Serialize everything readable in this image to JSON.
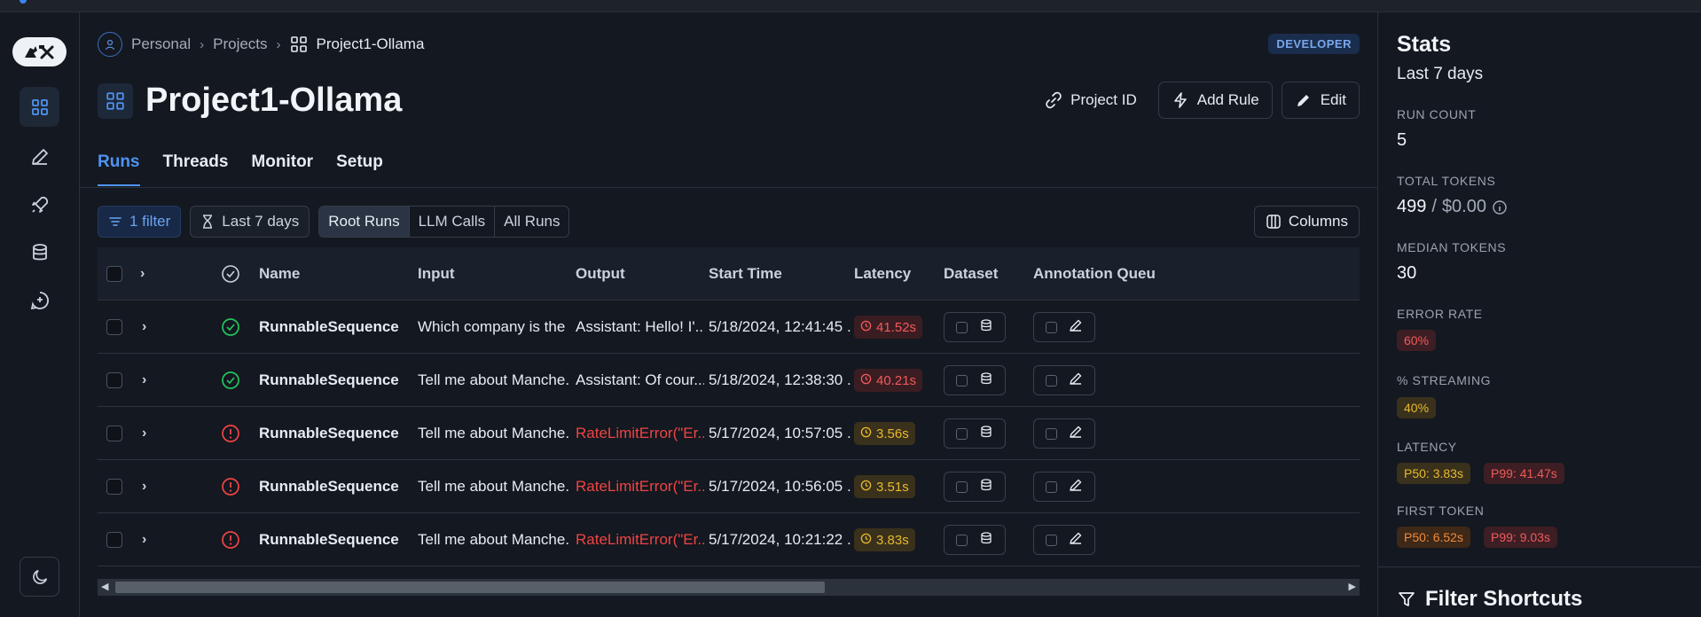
{
  "breadcrumb": {
    "items": [
      "Personal",
      "Projects"
    ],
    "current": "Project1-Ollama"
  },
  "badge": "DEVELOPER",
  "page": {
    "title": "Project1-Ollama"
  },
  "actions": {
    "project_id": "Project ID",
    "add_rule": "Add Rule",
    "edit": "Edit"
  },
  "tabs": [
    "Runs",
    "Threads",
    "Monitor",
    "Setup"
  ],
  "filters": {
    "filter_count": "1 filter",
    "time_range": "Last 7 days",
    "segments": [
      "Root Runs",
      "LLM Calls",
      "All Runs"
    ],
    "selected_segment": "Root Runs",
    "columns": "Columns"
  },
  "table": {
    "headers": {
      "name": "Name",
      "input": "Input",
      "output": "Output",
      "start_time": "Start Time",
      "latency": "Latency",
      "dataset": "Dataset",
      "annotation": "Annotation Queu"
    },
    "rows": [
      {
        "status": "success",
        "name": "RunnableSequence",
        "input": "Which company is the ...",
        "output": "Assistant: Hello! I'...",
        "output_error": false,
        "start_time": "5/18/2024, 12:41:45 ...",
        "latency": "41.52s",
        "latency_level": "red"
      },
      {
        "status": "success",
        "name": "RunnableSequence",
        "input": "Tell me about Manche...",
        "output": "Assistant: Of cour...",
        "output_error": false,
        "start_time": "5/18/2024, 12:38:30 ...",
        "latency": "40.21s",
        "latency_level": "red"
      },
      {
        "status": "error",
        "name": "RunnableSequence",
        "input": "Tell me about Manche...",
        "output": "RateLimitError(\"Er...",
        "output_error": true,
        "start_time": "5/17/2024, 10:57:05 ...",
        "latency": "3.56s",
        "latency_level": "yellow"
      },
      {
        "status": "error",
        "name": "RunnableSequence",
        "input": "Tell me about Manche...",
        "output": "RateLimitError(\"Er...",
        "output_error": true,
        "start_time": "5/17/2024, 10:56:05 ...",
        "latency": "3.51s",
        "latency_level": "yellow"
      },
      {
        "status": "error",
        "name": "RunnableSequence",
        "input": "Tell me about Manche...",
        "output": "RateLimitError(\"Er...",
        "output_error": true,
        "start_time": "5/17/2024, 10:21:22 ...",
        "latency": "3.83s",
        "latency_level": "yellow"
      }
    ]
  },
  "stats": {
    "title": "Stats",
    "subtitle": "Last 7 days",
    "run_count_label": "RUN COUNT",
    "run_count": "5",
    "total_tokens_label": "TOTAL TOKENS",
    "total_tokens": "499",
    "total_cost": "$0.00",
    "median_tokens_label": "MEDIAN TOKENS",
    "median_tokens": "30",
    "error_rate_label": "ERROR RATE",
    "error_rate": "60%",
    "streaming_label": "% STREAMING",
    "streaming": "40%",
    "latency_label": "LATENCY",
    "latency_p50": "P50: 3.83s",
    "latency_p99": "P99: 41.47s",
    "first_token_label": "FIRST TOKEN",
    "first_token_p50": "P50: 6.52s",
    "first_token_p99": "P99: 9.03s",
    "filter_shortcuts": "Filter Shortcuts"
  },
  "colors": {
    "accent": "#4f93f2",
    "success": "#22c55e",
    "error": "#ef4444",
    "warning": "#e7b92e"
  },
  "icons": {
    "rail": [
      "grid-icon",
      "pen-icon",
      "rocket-icon",
      "database-icon",
      "chat-plus-icon",
      "moon-icon"
    ]
  }
}
